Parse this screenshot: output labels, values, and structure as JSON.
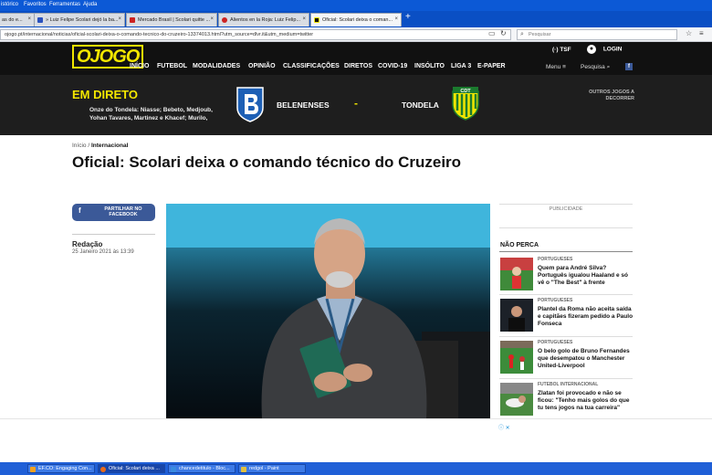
{
  "browser": {
    "menu": [
      "istórico",
      "Favoritos",
      "Ferramentas",
      "Ajuda"
    ],
    "tabs": [
      {
        "label": "as do e...",
        "icon_color": "#e8e8e8"
      },
      {
        "label": "» Luiz Felipe Scolari dejó la ba...",
        "icon_color": "#2a52be"
      },
      {
        "label": "Mercado Brasil | Scolari quitte ...",
        "icon_color": "#cc2222"
      },
      {
        "label": "Alientos en la Roja: Luiz Felip...",
        "icon_color": "#cc2222"
      },
      {
        "label": "Oficial: Scolari deixa o coman...",
        "icon_color": "#111111"
      }
    ],
    "new_tab": "+",
    "url": "ojogo.pt/internacional/noticias/oficial-scolari-deixa-o-comando-tecnico-do-cruzeiro-13374013.html?utm_source=dlvr.it&utm_medium=twitter",
    "search_placeholder": "Pesquisar"
  },
  "site": {
    "logo": "OJOGO",
    "nav": [
      "INÍCIO",
      "FUTEBOL",
      "MODALIDADES",
      "OPINIÃO",
      "CLASSIFICAÇÕES",
      "DIRETOS",
      "COVID-19",
      "INSÓLITO",
      "LIGA 3",
      "E-PAPER"
    ],
    "tsf": "TSF",
    "login": "LOGIN",
    "menu": "Menu",
    "search": "Pesquisa",
    "facebook": "f"
  },
  "live": {
    "title": "EM DIRETO",
    "lineup": "Onze do Tondela: Niasse; Bebeto, Medjoub, Yohan Tavares, Martinez e Khacef; Murilo,",
    "team_home": "BELENENSES",
    "separator": "-",
    "team_away": "TONDELA",
    "other_games": "OUTROS JOGOS A DECORRER"
  },
  "article": {
    "breadcrumb_home": "Início",
    "breadcrumb_sep": " / ",
    "breadcrumb_section": "Internacional",
    "headline": "Oficial: Scolari deixa o comando técnico do Cruzeiro",
    "share_label": "PARTILHAR NO FACEBOOK",
    "author": "Redação",
    "date": "25 Janeiro 2021 às 13:39"
  },
  "sidebar": {
    "publicidade": "PUBLICIDADE",
    "nao_perca": "NÃO PERCA",
    "items": [
      {
        "category": "PORTUGUESES",
        "title": "Quem para André Silva? Português igualou Haaland e só vê o \"The Best\" à frente"
      },
      {
        "category": "PORTUGUESES",
        "title": "Plantel da Roma não aceita saída e capitães fizeram pedido a Paulo Fonseca"
      },
      {
        "category": "PORTUGUESES",
        "title": "O belo golo de Bruno Fernandes que desempatou o Manchester United-Liverpool"
      },
      {
        "category": "FUTEBOL INTERNACIONAL",
        "title": "Zlatan foi provocado e não se ficou: \"Tenho mais golos do que tu tens jogos na tua carreira\""
      }
    ]
  },
  "taskbar": {
    "items": [
      {
        "label": "EF.CO: Engaging Con...",
        "icon_color": "#f0a020"
      },
      {
        "label": "Oficial: Scolari deixa ...",
        "icon_color": "#e86a1a"
      },
      {
        "label": "chancedetitulo - Bloc...",
        "icon_color": "#3a8be0"
      },
      {
        "label": "redgol - Paint",
        "icon_color": "#e0c040"
      }
    ]
  },
  "colors": {
    "brand_yellow": "#f2e600",
    "header_bg": "#111111",
    "facebook_blue": "#3b5998",
    "taskbar_blue": "#1f5fd7"
  }
}
